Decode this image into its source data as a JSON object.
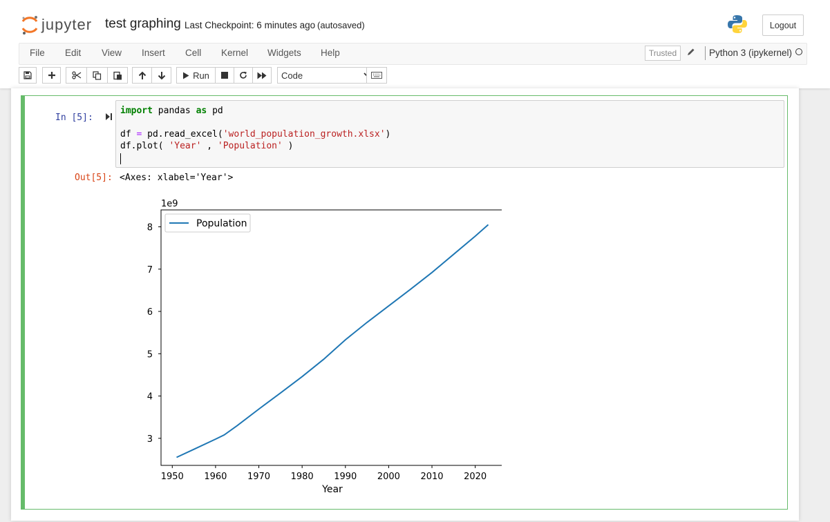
{
  "header": {
    "logo_text": "jupyter",
    "notebook_title": "test graphing",
    "checkpoint_text": "Last Checkpoint: 6 minutes ago",
    "autosave_text": "(autosaved)",
    "logout_label": "Logout"
  },
  "menu": {
    "items": [
      "File",
      "Edit",
      "View",
      "Insert",
      "Cell",
      "Kernel",
      "Widgets",
      "Help"
    ],
    "trusted_label": "Trusted",
    "kernel_name": "Python 3 (ipykernel)"
  },
  "toolbar": {
    "run_label": "Run",
    "cell_type": "Code"
  },
  "cell": {
    "in_prompt": "In [5]:",
    "code_lines": [
      "import pandas as pd",
      "",
      "df = pd.read_excel('world_population_growth.xlsx')",
      "df.plot( 'Year' , 'Population' )"
    ],
    "out_prompt": "Out[5]:",
    "out_text": "<Axes: xlabel='Year'>"
  },
  "chart_data": {
    "type": "line",
    "title": "",
    "xlabel": "Year",
    "ylabel": "",
    "y_offset_label": "1e9",
    "xlim": [
      1947.4,
      2026.6
    ],
    "ylim": [
      2.36,
      8.4
    ],
    "xticks": [
      1950,
      1960,
      1970,
      1980,
      1990,
      2000,
      2010,
      2020
    ],
    "yticks": [
      3,
      4,
      5,
      6,
      7,
      8
    ],
    "legend_position": "top-left",
    "grid": false,
    "series": [
      {
        "name": "Population",
        "color": "#1f77b4",
        "x": [
          1951,
          1955,
          1960,
          1962,
          1965,
          1970,
          1975,
          1980,
          1985,
          1990,
          1995,
          2000,
          2005,
          2010,
          2015,
          2020,
          2023
        ],
        "y": [
          2.55,
          2.74,
          2.98,
          3.08,
          3.3,
          3.69,
          4.07,
          4.46,
          4.87,
          5.33,
          5.74,
          6.13,
          6.52,
          6.92,
          7.35,
          7.78,
          8.05
        ]
      }
    ]
  }
}
